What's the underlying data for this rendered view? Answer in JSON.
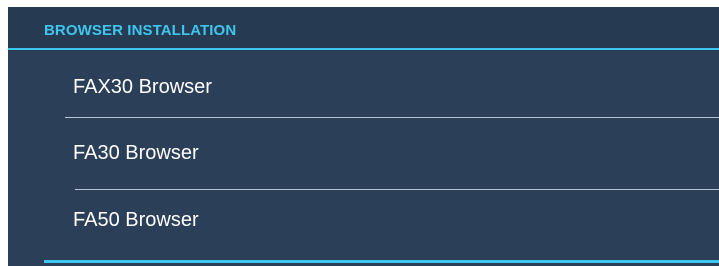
{
  "section": {
    "title": "BROWSER INSTALLATION"
  },
  "browsers": [
    {
      "label": "FAX30 Browser"
    },
    {
      "label": "FA30 Browser"
    },
    {
      "label": "FA50 Browser"
    }
  ],
  "colors": {
    "panel_background": "#2b3f58",
    "header_background": "#263a52",
    "accent": "#3ec6ef",
    "separator": "#b9c6d4",
    "text": "#ffffff"
  }
}
